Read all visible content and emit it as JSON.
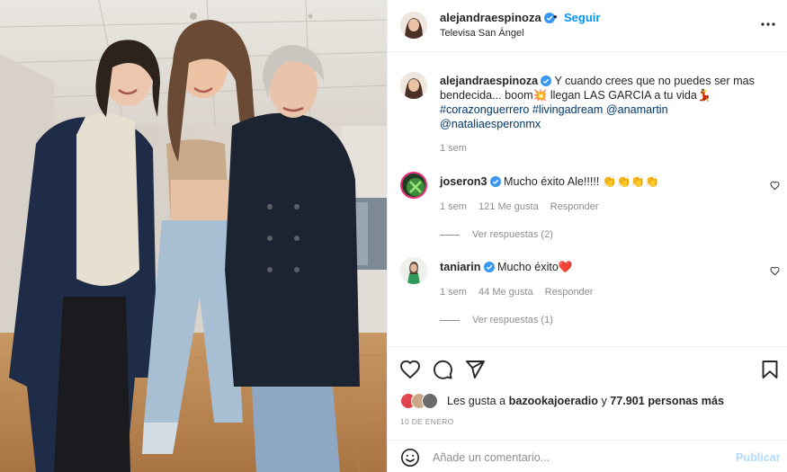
{
  "post": {
    "username": "alejandraespinoza",
    "follow_label": "Seguir",
    "separator": "•",
    "location": "Televisa San Ángel",
    "more_icon": "more-horizontal-icon"
  },
  "caption": {
    "username": "alejandraespinoza",
    "text_1": "Y cuando crees que no puedes ser mas bendecida... boom",
    "emoji_1": "💥",
    "text_2": "llegan LAS GARCIA a tu vida",
    "emoji_2": "💃",
    "hashtag_1": "#corazonguerrero",
    "hashtag_2": "#livingadream",
    "mention_1": "@anamartin",
    "mention_2": "@nataliaesperonmx",
    "time": "1 sem"
  },
  "comments": [
    {
      "username": "joseron3",
      "verified": true,
      "text": "Mucho éxito Ale!!!!!",
      "emoji": "👏👏👏👏",
      "time": "1 sem",
      "likes": "121 Me gusta",
      "reply_label": "Responder",
      "view_replies": "Ver respuestas (2)"
    },
    {
      "username": "taniarin",
      "verified": true,
      "text": "Mucho éxito",
      "emoji": "❤️",
      "time": "1 sem",
      "likes": "44 Me gusta",
      "reply_label": "Responder",
      "view_replies": "Ver respuestas (1)"
    }
  ],
  "actions": {
    "like_icon": "heart-icon",
    "comment_icon": "comment-icon",
    "share_icon": "paper-plane-icon",
    "save_icon": "bookmark-icon"
  },
  "likes": {
    "prefix": "Les gusta a",
    "user": "bazookajoeradio",
    "middle": "y",
    "count": "77.901 personas más"
  },
  "date": "10 DE ENERO",
  "add_comment": {
    "placeholder": "Añade un comentario...",
    "post_label": "Publicar",
    "emoji_icon": "smiley-icon"
  },
  "colors": {
    "accent": "#0095f6",
    "tag": "#00376b",
    "muted": "#8e8e8e",
    "post_disabled": "#b3dbff",
    "verified": "#3897f0",
    "heart_red": "#ed4956"
  }
}
